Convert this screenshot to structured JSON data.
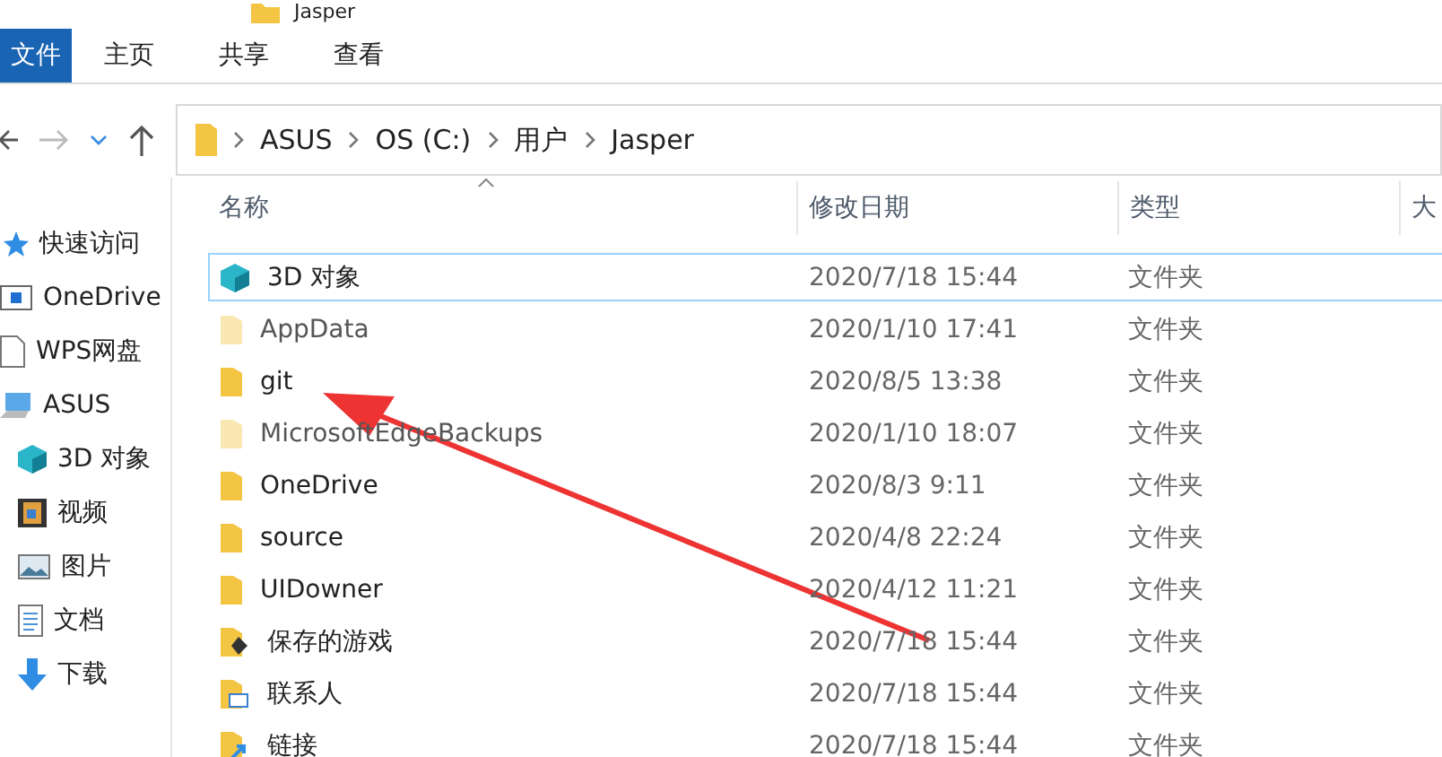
{
  "window": {
    "title": "Jasper"
  },
  "ribbon_tabs": [
    {
      "label": "文件",
      "selected": true
    },
    {
      "label": "主页",
      "selected": false
    },
    {
      "label": "共享",
      "selected": false
    },
    {
      "label": "查看",
      "selected": false
    }
  ],
  "address_bar": {
    "path": [
      "ASUS",
      "OS (C:)",
      "用户",
      "Jasper"
    ]
  },
  "sidebar": {
    "items": [
      {
        "label": "快速访问",
        "kind": "star"
      },
      {
        "label": "OneDrive",
        "kind": "cloud"
      },
      {
        "label": "WPS网盘",
        "kind": "page"
      },
      {
        "label": "ASUS",
        "kind": "computer",
        "children": [
          {
            "label": "3D 对象",
            "kind": "cube"
          },
          {
            "label": "视频",
            "kind": "film"
          },
          {
            "label": "图片",
            "kind": "picture"
          },
          {
            "label": "文档",
            "kind": "doc"
          },
          {
            "label": "下载",
            "kind": "download"
          }
        ]
      }
    ]
  },
  "table": {
    "columns": [
      "名称",
      "修改日期",
      "类型",
      "大"
    ],
    "rows": [
      {
        "name": "3D 对象",
        "date": "2020/7/18 15:44",
        "type": "文件夹",
        "kind": "cube",
        "hidden": false,
        "selected": true
      },
      {
        "name": "AppData",
        "date": "2020/1/10 17:41",
        "type": "文件夹",
        "kind": "folder",
        "hidden": true,
        "selected": false
      },
      {
        "name": "git",
        "date": "2020/8/5 13:38",
        "type": "文件夹",
        "kind": "folder",
        "hidden": false,
        "selected": false
      },
      {
        "name": "MicrosoftEdgeBackups",
        "date": "2020/1/10 18:07",
        "type": "文件夹",
        "kind": "folder",
        "hidden": true,
        "selected": false
      },
      {
        "name": "OneDrive",
        "date": "2020/8/3 9:11",
        "type": "文件夹",
        "kind": "folder",
        "hidden": false,
        "selected": false
      },
      {
        "name": "source",
        "date": "2020/4/8 22:24",
        "type": "文件夹",
        "kind": "folder",
        "hidden": false,
        "selected": false
      },
      {
        "name": "UIDowner",
        "date": "2020/4/12 11:21",
        "type": "文件夹",
        "kind": "folder",
        "hidden": false,
        "selected": false
      },
      {
        "name": "保存的游戏",
        "date": "2020/7/18 15:44",
        "type": "文件夹",
        "kind": "games",
        "hidden": false,
        "selected": false
      },
      {
        "name": "联系人",
        "date": "2020/7/18 15:44",
        "type": "文件夹",
        "kind": "contacts",
        "hidden": false,
        "selected": false
      },
      {
        "name": "链接",
        "date": "2020/7/18 15:44",
        "type": "文件夹",
        "kind": "links",
        "hidden": false,
        "selected": false
      }
    ]
  }
}
